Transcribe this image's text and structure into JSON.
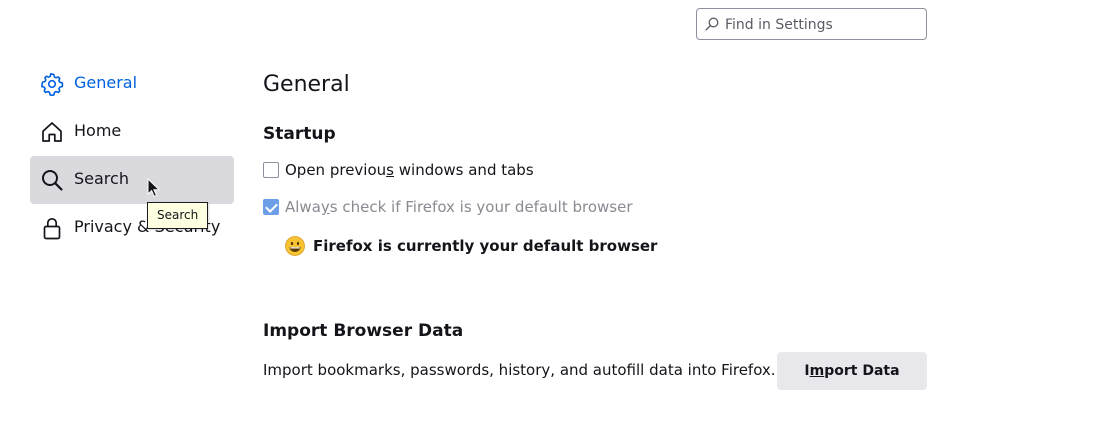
{
  "search": {
    "placeholder": "Find in Settings",
    "value": ""
  },
  "sidebar": {
    "items": [
      {
        "label": "General",
        "icon": "gear-icon",
        "state": "selected"
      },
      {
        "label": "Home",
        "icon": "home-icon",
        "state": "normal"
      },
      {
        "label": "Search",
        "icon": "search-icon",
        "state": "hovered"
      },
      {
        "label": "Privacy & Security",
        "icon": "lock-icon",
        "state": "normal"
      }
    ]
  },
  "tooltip": {
    "text": "Search"
  },
  "main": {
    "title": "General",
    "startup": {
      "heading": "Startup",
      "open_previous": {
        "label_before": "Open previou",
        "access_key": "s",
        "label_after": " windows and tabs",
        "checked": false
      },
      "default_check": {
        "label_before": "Alwa",
        "access_key": "y",
        "label_after": "s check if Firefox is your default browser",
        "checked": true,
        "disabled": true
      },
      "default_status": "Firefox is currently your default browser"
    },
    "import": {
      "heading": "Import Browser Data",
      "description": "Import bookmarks, passwords, history, and autofill data into Firefox.",
      "button_before": "I",
      "button_access_key": "m",
      "button_after": "port Data"
    }
  },
  "colors": {
    "accent": "#0061e0",
    "hover_bg": "#dadade",
    "checkbox_checked": "#6d9fe6",
    "tooltip_bg": "#ffffe1",
    "button_bg": "#e8e8ec"
  }
}
